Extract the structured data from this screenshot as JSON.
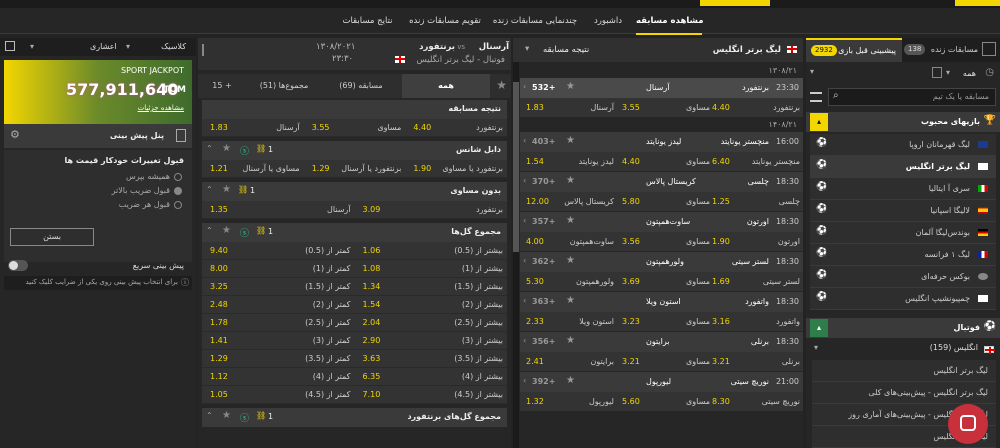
{
  "top_nav": {
    "live_tab": "مشاهده مسابقه",
    "dashboard": "داشبورد",
    "multiview": "چندنمایی مسابقات زنده",
    "calendar": "تقویم مسابقات زنده",
    "results": "نتایج مسابقات"
  },
  "right_panel": {
    "tab_live": "مسابقات زنده",
    "tab_live_count": "138",
    "tab_pre": "پیشبینی قبل بازی",
    "tab_pre_count": "2932",
    "all": "همه",
    "search_placeholder": "مسابقه یا یک تیم",
    "favorites": "بازیهای محبوب",
    "leagues": [
      {
        "name": "لیگ قهرمانان اروپا",
        "flag": "eu"
      },
      {
        "name": "لیگ برتر انگلیس",
        "flag": "en"
      },
      {
        "name": "سری آ ایتالیا",
        "flag": "it"
      },
      {
        "name": "لالیگا اسپانیا",
        "flag": "es"
      },
      {
        "name": "بوندس‌لیگا آلمان",
        "flag": "de"
      },
      {
        "name": "لیگ ۱ فرانسه",
        "flag": "fr"
      },
      {
        "name": "بوکس حرفه‌ای",
        "flag": "world"
      },
      {
        "name": "چمپیونشیپ انگلیس",
        "flag": "en"
      }
    ],
    "sport": "فوتبال",
    "country": "انگلیس (159)",
    "country_leagues": [
      "لیگ برتر انگلیس",
      "لیگ برتر انگلیس - پیش‌بینی‌های کلی",
      "لیگ برتر انگلیس - پیش‌بینی‌های آماری روز",
      "لیگ برتر انگلیس"
    ]
  },
  "match_list": {
    "league": "لیگ برتر انگلیس",
    "result_label": "نتیجه مسابقه",
    "dates": [
      "۱۳۰۸/۲۱",
      "۱۴۰۸/۲۱"
    ],
    "matches": [
      {
        "time": "23:30",
        "home": "برنتفورد",
        "away": "آرسنال",
        "more": "532+",
        "odds": [
          "1.83",
          "3.55",
          "4.40"
        ],
        "labels": [
          "آرسنال",
          "مساوی",
          "برنتفورد"
        ],
        "highlight": true
      },
      {
        "time": "16:00",
        "home": "منچستر یونایتد",
        "away": "لیدز یونایتد",
        "more": "403+",
        "odds": [
          "1.54",
          "4.40",
          "6.40"
        ],
        "labels": [
          "لیدز یونایتد",
          "مساوی",
          "منچستر یونایتد"
        ]
      },
      {
        "time": "18:30",
        "home": "چلسی",
        "away": "کریستال پالاس",
        "more": "370+",
        "odds": [
          "12.00",
          "5.80",
          "1.25"
        ],
        "labels": [
          "کریستال پالاس",
          "مساوی",
          "چلسی"
        ]
      },
      {
        "time": "18:30",
        "home": "اورتون",
        "away": "ساوت‌همپتون",
        "more": "357+",
        "odds": [
          "4.00",
          "3.56",
          "1.90"
        ],
        "labels": [
          "ساوت‌همپتون",
          "مساوی",
          "اورتون"
        ]
      },
      {
        "time": "18:30",
        "home": "لستر سیتی",
        "away": "ولورهمپتون",
        "more": "362+",
        "odds": [
          "5.30",
          "3.69",
          "1.69"
        ],
        "labels": [
          "ولورهمپتون",
          "مساوی",
          "لستر سیتی"
        ]
      },
      {
        "time": "18:30",
        "home": "واتفورد",
        "away": "استون ویلا",
        "more": "363+",
        "odds": [
          "2.33",
          "3.23",
          "3.16"
        ],
        "labels": [
          "استون ویلا",
          "مساوی",
          "واتفورد"
        ]
      },
      {
        "time": "18:30",
        "home": "برنلی",
        "away": "برایتون",
        "more": "356+",
        "odds": [
          "2.41",
          "3.21",
          "3.21"
        ],
        "labels": [
          "برایتون",
          "مساوی",
          "برنلی"
        ]
      },
      {
        "time": "21:00",
        "home": "نوریچ سیتی",
        "away": "لیورپول",
        "more": "392+",
        "odds": [
          "1.32",
          "5.60",
          "8.30"
        ],
        "labels": [
          "لیورپول",
          "مساوی",
          "نوریچ سیتی"
        ]
      }
    ]
  },
  "detail": {
    "home": "برنتفورد",
    "vs": "vs",
    "away": "آرسنال",
    "date": "۱۳۰۸/۲۰۲۱",
    "time": "۲۳:۳۰",
    "league": "فوتبال - لیگ برتر انگلیس",
    "tab_all": "همه",
    "tab_match": "مسابقه (69)",
    "tab_totals": "مجموع‌ها (51)",
    "tab_more": "15 +",
    "markets": [
      {
        "title": "نتیجه مسابقه",
        "rows": [
          [
            "برنتفورد",
            "4.40",
            "مساوی",
            "3.55",
            "آرسنال",
            "1.83"
          ]
        ]
      },
      {
        "title": "دابل شانس",
        "rows": [
          [
            "برنتفورد یا مساوی",
            "1.90",
            "برنتفورد یا آرسنال",
            "1.29",
            "مساوی یا آرسنال",
            "1.21"
          ]
        ]
      },
      {
        "title": "بدون مساوی",
        "rows": [
          [
            "برنتفورد",
            "3.09",
            "آرسنال",
            "1.35"
          ]
        ]
      },
      {
        "title": "مجموع گل‌ها",
        "rows": [
          [
            "بیشتر از (0.5)",
            "1.06",
            "کمتر از (0.5)",
            "9.40"
          ],
          [
            "بیشتر از (1)",
            "1.08",
            "کمتر از (1)",
            "8.00"
          ],
          [
            "بیشتر از (1.5)",
            "1.34",
            "کمتر از (1.5)",
            "3.25"
          ],
          [
            "بیشتر از (2)",
            "1.54",
            "کمتر از (2)",
            "2.48"
          ],
          [
            "بیشتر از (2.5)",
            "2.04",
            "کمتر از (2.5)",
            "1.78"
          ],
          [
            "بیشتر از (3)",
            "2.90",
            "کمتر از (3)",
            "1.41"
          ],
          [
            "بیشتر از (3.5)",
            "3.63",
            "کمتر از (3.5)",
            "1.29"
          ],
          [
            "بیشتر از (4)",
            "6.35",
            "کمتر از (4)",
            "1.12"
          ],
          [
            "بیشتر از (4.5)",
            "7.10",
            "کمتر از (4.5)",
            "1.05"
          ]
        ]
      },
      {
        "title": "مجموع گل‌های برنتفورد",
        "rows": []
      }
    ],
    "one_label": "1"
  },
  "betslip": {
    "mode": "کلاسیک",
    "odds_format": "اعشاری",
    "jackpot_title": "SPORT JACKPOT",
    "jackpot_amount": "577,911,640",
    "currency": "TOM",
    "jackpot_details": "مشاهده جزئیات",
    "panel_title": "پنل پیش بینی",
    "accept_title": "قبول تغییرات خودکار قیمت ها",
    "options": [
      "همیشه بپرس",
      "قبول ضریب بالاتر",
      "قبول هر ضریب"
    ],
    "close_btn": "بستن",
    "quick_bet": "پیش بینی سریع",
    "quick_hint": "برای انتخاب پیش بینی روی یکی از ضرایب کلیک کنید"
  },
  "colors": {
    "accent": "#f3d600",
    "green": "#2f7d4a",
    "dark": "#232323"
  }
}
